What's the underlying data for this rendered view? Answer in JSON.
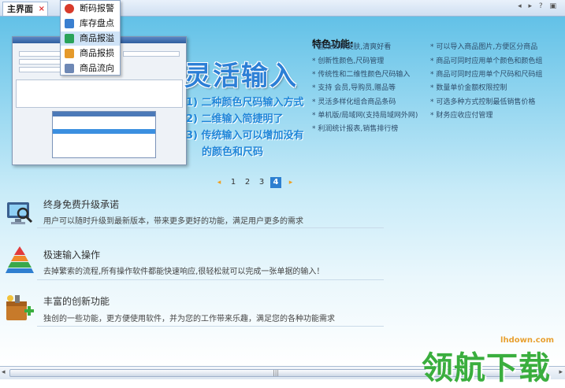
{
  "tabbar": {
    "tab_label": "主界面",
    "close_glyph": "×",
    "nav_glyphs": "◂ ▸ ? ▣"
  },
  "menu": {
    "items": [
      {
        "label": "断码报警",
        "icon": "alarm-icon",
        "color": "#d83b2b"
      },
      {
        "label": "库存盘点",
        "icon": "inventory-icon",
        "color": "#3a7fd0"
      },
      {
        "label": "商品报溢",
        "icon": "overflow-icon",
        "color": "#2aa35a"
      },
      {
        "label": "商品报损",
        "icon": "loss-icon",
        "color": "#e59a2b"
      },
      {
        "label": "商品流向",
        "icon": "flow-icon",
        "color": "#6e88b5"
      }
    ]
  },
  "hero": {
    "title": "灵活输入",
    "points": [
      "1) 二种颜色尺码输入方式",
      "2) 二维输入简捷明了",
      "3) 传统输入可以增加没有",
      "的颜色和尺码"
    ]
  },
  "features": {
    "title": "特色功能:",
    "left": [
      "* 翻炫四种皮肤,清爽好看",
      "* 创新性颜色,尺码管理",
      "* 传统性和二维性颜色尺码输入",
      "* 支持 会员,导购员,赠品等",
      "* 灵活多样化组合商品条码",
      "* 单机版/局域网(支持局域网外网)",
      "* 利润统计报表,销售排行榜"
    ],
    "right": [
      "* 可以导入商品图片,方便区分商品",
      "* 商品可同时应用单个颜色和颜色组",
      "* 商品可同时应用单个尺码和尺码组",
      "* 数量单价金额权限控制",
      "* 可选多种方式控制最低销售价格",
      "* 财务应收应付管理"
    ]
  },
  "pager": {
    "pages": [
      "1",
      "2",
      "3",
      "4"
    ],
    "active": "4",
    "prev": "◂",
    "next": "▸"
  },
  "sections": [
    {
      "title": "终身免费升级承诺",
      "desc": "用户可以随时升级到最新版本，带来更多更好的功能，满足用户更多的需求",
      "icon": "monitor-icon"
    },
    {
      "title": "极速输入操作",
      "desc": "去掉繁索的流程,所有操作软件都能快速响应,很轻松就可以完成一张单据的输入！",
      "icon": "pyramid-icon"
    },
    {
      "title": "丰富的创新功能",
      "desc": "独创的一些功能，更方便使用软件，并为您的工作带来乐趣，满足您的各种功能需求",
      "icon": "toolbox-icon"
    }
  ],
  "scrollbar": {
    "left": "◂",
    "right": "▸",
    "grip": "|||"
  },
  "watermark": {
    "text": "领航下载",
    "url": "lhdown.com"
  }
}
